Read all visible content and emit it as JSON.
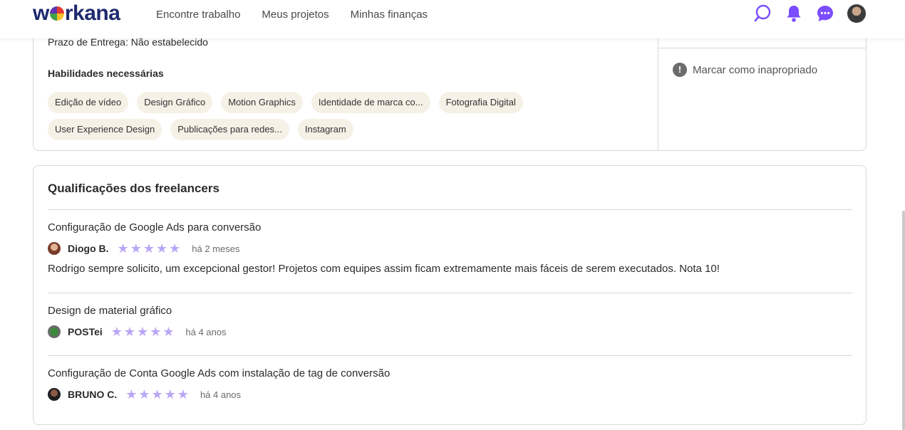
{
  "header": {
    "logo": "workana",
    "nav": [
      "Encontre trabalho",
      "Meus projetos",
      "Minhas finanças"
    ]
  },
  "project": {
    "deadline": "Prazo de Entrega: Não estabelecido",
    "skills_title": "Habilidades necessárias",
    "skills": [
      "Edição de vídeo",
      "Design Gráfico",
      "Motion Graphics",
      "Identidade de marca co...",
      "Fotografia Digital",
      "User Experience Design",
      "Publicações para redes...",
      "Instagram"
    ],
    "report_label": "Marcar como inapropriado"
  },
  "qualifications": {
    "title": "Qualificações dos freelancers",
    "items": [
      {
        "title": "Configuração de Google Ads para conversão",
        "reviewer": "Diogo B.",
        "rating": 5,
        "time": "há 2 meses",
        "comment": "Rodrigo sempre solicito, um excepcional gestor! Projetos com equipes assim ficam extremamente mais fáceis de serem executados. Nota 10!"
      },
      {
        "title": "Design de material gráfico",
        "reviewer": "POSTei",
        "rating": 5,
        "time": "há 4 anos",
        "comment": ""
      },
      {
        "title": "Configuração de Conta Google Ads com instalação de tag de conversão",
        "reviewer": "BRUNO C.",
        "rating": 5,
        "time": "há 4 anos",
        "comment": ""
      }
    ]
  },
  "colors": {
    "accent": "#7c4dff",
    "star": "#b9a6f6",
    "chip": "#f6f1e7",
    "brand": "#1e2a6e"
  }
}
